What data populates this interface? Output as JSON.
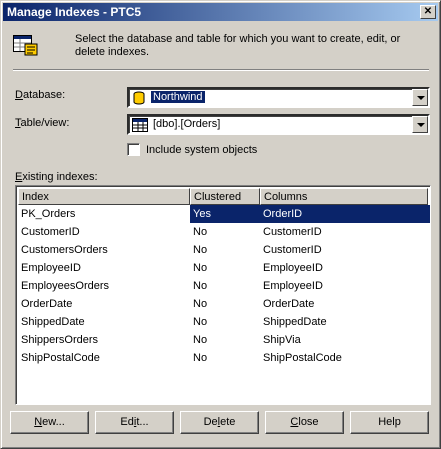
{
  "window": {
    "title": "Manage Indexes - PTC5"
  },
  "instructions": "Select the database and table for which you want to create, edit, or delete indexes.",
  "database": {
    "label_underlined": "D",
    "label_rest": "atabase:",
    "value": "Northwind"
  },
  "table": {
    "label_underlined": "T",
    "label_rest": "able/view:",
    "value": "[dbo].[Orders]"
  },
  "system_objects": {
    "label": "Include system objects",
    "checked": false
  },
  "existing": {
    "label_underlined": "E",
    "label_rest": "xisting indexes:"
  },
  "columns": [
    "Index",
    "Clustered",
    "Columns"
  ],
  "rows": [
    {
      "index": "PK_Orders",
      "clustered": "Yes",
      "columns": "OrderID",
      "selected": true
    },
    {
      "index": "CustomerID",
      "clustered": "No",
      "columns": "CustomerID"
    },
    {
      "index": "CustomersOrders",
      "clustered": "No",
      "columns": "CustomerID"
    },
    {
      "index": "EmployeeID",
      "clustered": "No",
      "columns": "EmployeeID"
    },
    {
      "index": "EmployeesOrders",
      "clustered": "No",
      "columns": "EmployeeID"
    },
    {
      "index": "OrderDate",
      "clustered": "No",
      "columns": "OrderDate"
    },
    {
      "index": "ShippedDate",
      "clustered": "No",
      "columns": "ShippedDate"
    },
    {
      "index": "ShippersOrders",
      "clustered": "No",
      "columns": "ShipVia"
    },
    {
      "index": "ShipPostalCode",
      "clustered": "No",
      "columns": "ShipPostalCode"
    }
  ],
  "buttons": {
    "new": {
      "pre": "",
      "u": "N",
      "post": "ew..."
    },
    "edit": {
      "pre": "Ed",
      "u": "i",
      "post": "t..."
    },
    "delete": {
      "pre": "De",
      "u": "l",
      "post": "ete"
    },
    "close": {
      "pre": "",
      "u": "C",
      "post": "lose"
    },
    "help": {
      "pre": "Help",
      "u": "",
      "post": ""
    }
  },
  "colors": {
    "titlebar_start": "#0a246a",
    "titlebar_end": "#a6caf0",
    "selection": "#0a246a",
    "face": "#d4d0c8"
  }
}
